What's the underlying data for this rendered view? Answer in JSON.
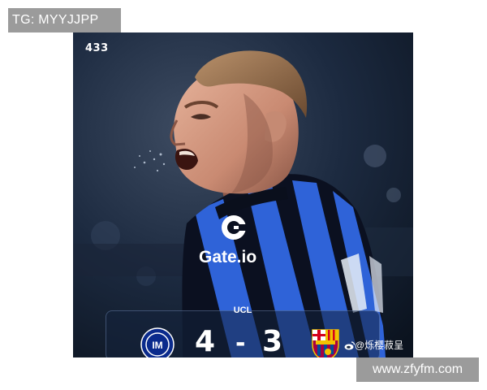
{
  "watermark_top": "TG: MYYJJPP",
  "watermark_bottom": "www.zfyfm.com",
  "photo": {
    "brand_logo": "433",
    "sponsor_text": "Gate.io",
    "scoreboard": {
      "competition": "UCL",
      "home_score": "4",
      "separator": "-",
      "away_score": "3",
      "home_crest": "inter-milan-crest-icon",
      "away_crest": "fc-barcelona-crest-icon",
      "handle": "@烁樱菽呈"
    }
  }
}
